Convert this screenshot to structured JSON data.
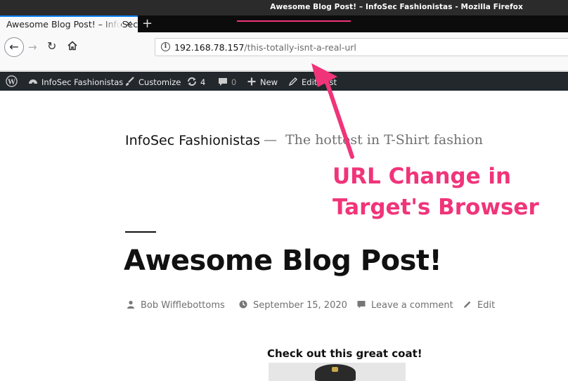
{
  "window": {
    "title": "Awesome Blog Post! – InfoSec Fashionistas - Mozilla Firefox"
  },
  "tabs": [
    {
      "label": "Awesome Blog Post! – InfoSec Fashionistas"
    }
  ],
  "urlbar": {
    "host": "192.168.78.157",
    "path": "/this-totally-isnt-a-real-url"
  },
  "adminbar": {
    "site_name": "InfoSec Fashionistas",
    "customize": "Customize",
    "updates_count": "4",
    "comments_count": "0",
    "new_label": "New",
    "edit_post": "Edit Post"
  },
  "site": {
    "title": "InfoSec Fashionistas",
    "separator": "—",
    "tagline": "The hottest in T-Shirt fashion"
  },
  "post": {
    "title": "Awesome Blog Post!",
    "author": "Bob Wifflebottoms",
    "date": "September 15, 2020",
    "comment_link": "Leave a comment",
    "edit_link": "Edit",
    "caption": "Check out this great coat!"
  },
  "annotation": {
    "line1": "URL Change in",
    "line2": "Target's Browser",
    "color": "#f0347a"
  },
  "icons": [
    "wordpress-icon",
    "dashboard-icon",
    "brush-icon",
    "refresh-icon",
    "comment-icon",
    "plus-icon",
    "pencil-icon",
    "user-icon",
    "clock-icon",
    "info-icon",
    "home-icon"
  ]
}
